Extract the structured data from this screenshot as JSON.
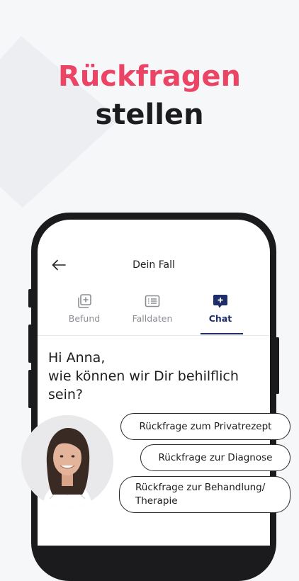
{
  "headline": {
    "line1": "Rückfragen",
    "line2": "stellen",
    "accent_color": "#ec4464"
  },
  "appbar": {
    "title": "Dein Fall",
    "back_icon": "arrow-left-icon"
  },
  "tabs": [
    {
      "label": "Befund",
      "icon": "add-document-icon",
      "active": false
    },
    {
      "label": "Falldaten",
      "icon": "list-card-icon",
      "active": false
    },
    {
      "label": "Chat",
      "icon": "chat-plus-icon",
      "active": true
    }
  ],
  "chat": {
    "greeting_line1": "Hi Anna,",
    "greeting_line2": "wie können wir Dir behilflich",
    "greeting_line3": "sein?"
  },
  "quick_replies": [
    {
      "label": "Rückfrage zum Privatrezept"
    },
    {
      "label": "Rückfrage zur Diagnose"
    },
    {
      "label_line1": "Rückfrage zur Behandlung/",
      "label_line2": "Therapie"
    }
  ],
  "colors": {
    "navy": "#1f2d6b",
    "inactive": "#8a8d93"
  }
}
